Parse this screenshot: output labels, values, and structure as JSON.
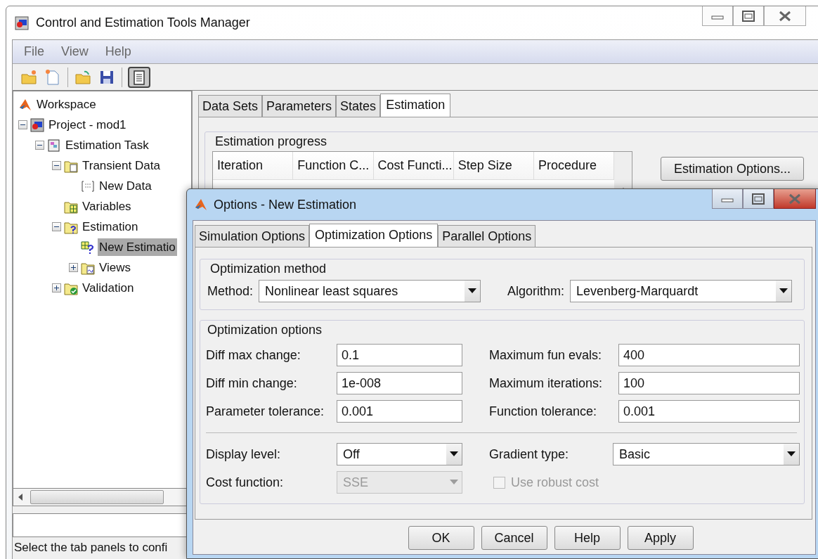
{
  "window": {
    "title": "Control and Estimation Tools Manager"
  },
  "menu": [
    "File",
    "View",
    "Help"
  ],
  "toolbar": [
    {
      "kind": "new-project",
      "pressed": false
    },
    {
      "kind": "new-document",
      "pressed": false
    },
    {
      "kind": "separator"
    },
    {
      "kind": "open",
      "pressed": false
    },
    {
      "kind": "save",
      "pressed": false
    },
    {
      "kind": "separator"
    },
    {
      "kind": "notes",
      "pressed": true
    }
  ],
  "tree": [
    {
      "label": "Workspace",
      "kind": "matlab",
      "selected": false,
      "children": [
        {
          "label": "Project - mod1",
          "kind": "project",
          "expanded": true,
          "selected": false,
          "children": [
            {
              "label": "Estimation Task",
              "kind": "task",
              "expanded": true,
              "selected": false,
              "children": [
                {
                  "label": "Transient Data",
                  "kind": "data-folder",
                  "expanded": true,
                  "selected": false,
                  "children": [
                    {
                      "label": "New Data",
                      "kind": "data",
                      "selected": false
                    }
                  ]
                },
                {
                  "label": "Variables",
                  "kind": "variables-folder",
                  "selected": false
                },
                {
                  "label": "Estimation",
                  "kind": "estimation-folder",
                  "expanded": true,
                  "selected": false,
                  "children": [
                    {
                      "label": "New Estimatio",
                      "kind": "estimation",
                      "selected": true
                    },
                    {
                      "label": "Views",
                      "kind": "views-folder",
                      "expanded": false,
                      "selected": false
                    }
                  ]
                },
                {
                  "label": "Validation",
                  "kind": "validation-folder",
                  "expanded": false,
                  "selected": false
                }
              ]
            }
          ]
        }
      ]
    }
  ],
  "tabs": [
    {
      "label": "Data Sets",
      "selected": false
    },
    {
      "label": "Parameters",
      "selected": false
    },
    {
      "label": "States",
      "selected": false
    },
    {
      "label": "Estimation",
      "selected": true
    }
  ],
  "progress": {
    "title": "Estimation progress",
    "columns": [
      "Iteration",
      "Function C...",
      "Cost Functi...",
      "Step Size",
      "Procedure"
    ],
    "button": "Estimation Options..."
  },
  "status_bar": "Select the tab panels to confi",
  "dialog": {
    "title": "Options - New Estimation",
    "tabs": [
      {
        "label": "Simulation Options",
        "selected": false
      },
      {
        "label": "Optimization Options",
        "selected": true
      },
      {
        "label": "Parallel Options",
        "selected": false
      }
    ],
    "method_group": {
      "title": "Optimization method",
      "fields": [
        {
          "label": "Method:",
          "value": "Nonlinear least squares"
        },
        {
          "label": "Algorithm:",
          "value": "Levenberg-Marquardt"
        }
      ]
    },
    "options_group": {
      "title": "Optimization options",
      "blocks": [
        {
          "rows": [
            [
              {
                "kind": "text",
                "label": "Diff max change:",
                "value": "0.1"
              },
              {
                "kind": "text",
                "label": "Maximum fun evals:",
                "value": "400"
              }
            ],
            [
              {
                "kind": "text",
                "label": "Diff min change:",
                "value": "1e-008"
              },
              {
                "kind": "text",
                "label": "Maximum iterations:",
                "value": "100"
              }
            ],
            [
              {
                "kind": "text",
                "label": "Parameter tolerance:",
                "value": "0.001"
              },
              {
                "kind": "text",
                "label": "Function tolerance:",
                "value": "0.001"
              }
            ]
          ]
        },
        {
          "rows": [
            [
              {
                "kind": "combo",
                "label": "Display level:",
                "value": "Off",
                "disabled": false
              },
              {
                "kind": "combo",
                "label": "Gradient type:",
                "value": "Basic",
                "disabled": false
              }
            ],
            [
              {
                "kind": "combo",
                "label": "Cost function:",
                "value": "SSE",
                "disabled": true
              },
              {
                "kind": "checkbox",
                "label": "Use robust cost",
                "checked": false,
                "disabled": true
              }
            ]
          ]
        }
      ]
    },
    "buttons": [
      "OK",
      "Cancel",
      "Help",
      "Apply"
    ]
  }
}
